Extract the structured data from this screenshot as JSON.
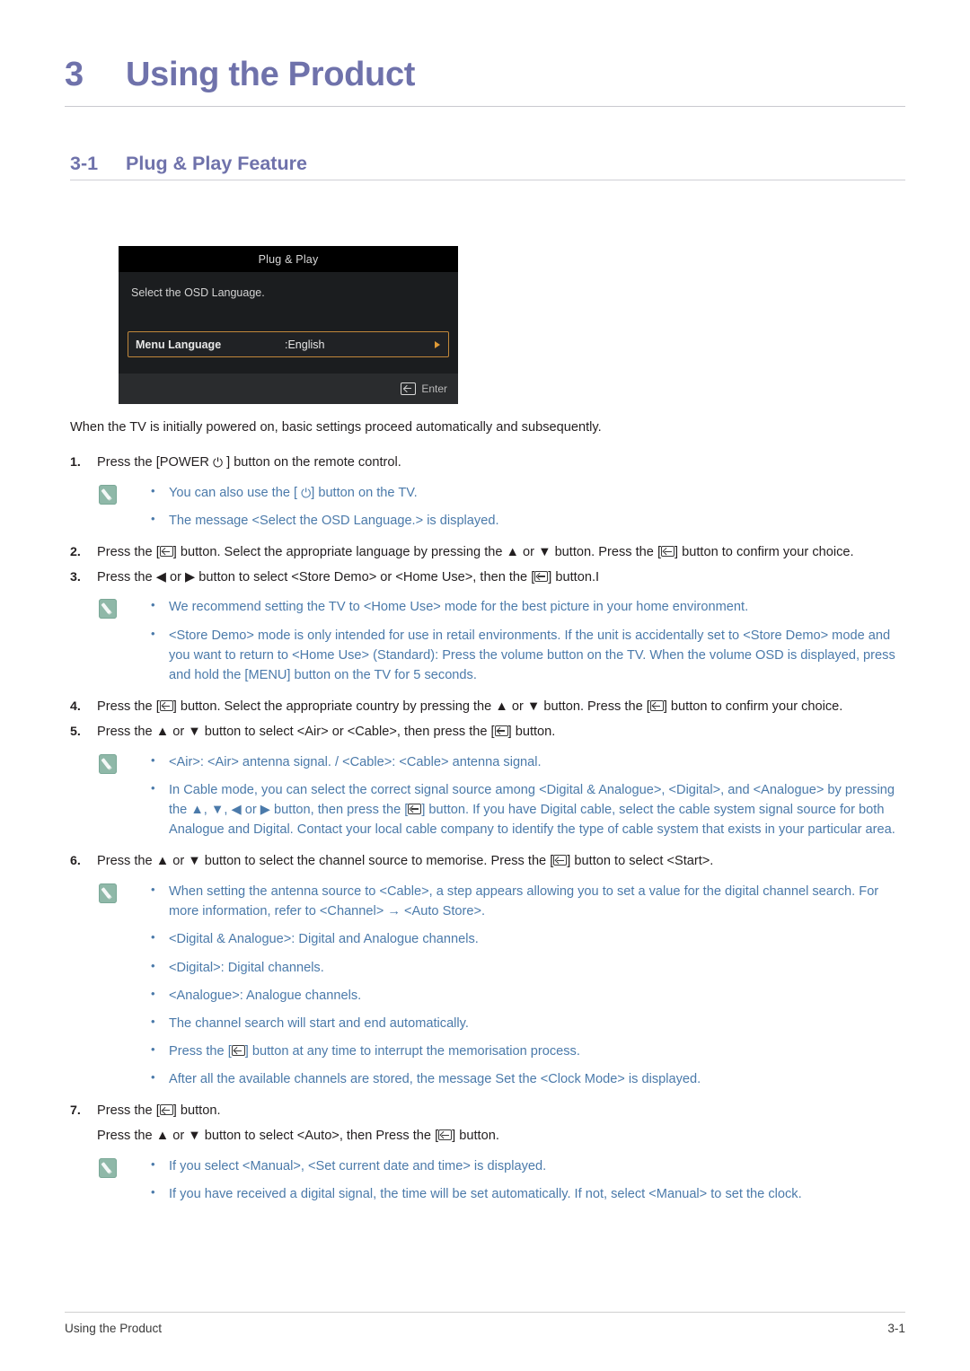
{
  "chapter": {
    "number": "3",
    "title": "Using the Product"
  },
  "section": {
    "number": "3-1",
    "title": "Plug & Play Feature"
  },
  "figure": {
    "name": "plug-and-play-osd",
    "title": "Plug & Play",
    "prompt": "Select the OSD Language.",
    "row_label": "Menu Language",
    "row_value": ":English",
    "footer_action": "Enter",
    "colors": {
      "titlebar_bg": "#000000",
      "body_bg": "#1b1d1f",
      "footer_bg": "#2a2c2e",
      "highlight_border": "#c0873a",
      "arrow": "#e09a36"
    }
  },
  "intro": "When the TV is initially powered on, basic settings proceed automatically and subsequently.",
  "steps": [
    {
      "number": "1.",
      "text_before": "Press the [POWER ",
      "icon": "power-icon",
      "text_after": " ] button on the remote control."
    },
    {
      "number": "2.",
      "parts": [
        "Press the [",
        "] button. Select the appropriate language by pressing the ▲ or ▼ button. Press the [",
        "] button to confirm your choice."
      ]
    },
    {
      "number": "3.",
      "parts": [
        "Press the ◀ or ▶ button to select <Store Demo> or <Home Use>, then the [",
        "] button.I"
      ]
    },
    {
      "number": "4.",
      "parts": [
        "Press the [",
        "] button. Select the appropriate country by pressing the ▲ or ▼ button. Press the [",
        "] button to confirm your choice."
      ]
    },
    {
      "number": "5.",
      "parts": [
        "Press the ▲ or ▼ button to select <Air> or <Cable>, then press the [",
        "] button."
      ]
    },
    {
      "number": "6.",
      "parts": [
        "Press the ▲ or ▼ button to select the channel source to memorise. Press the [",
        "] button to select <Start>."
      ]
    },
    {
      "number": "7.",
      "parts": [
        "Press the [",
        "] button."
      ],
      "substep_parts": [
        "Press the ▲ or ▼ button to select <Auto>, then Press the [",
        "] button."
      ]
    }
  ],
  "notes": [
    {
      "id": "note-after-step-1",
      "items": [
        {
          "parts": [
            "You can also use the [ ",
            "] button on the TV."
          ],
          "inline_icon": "power-icon"
        },
        {
          "text": "The message <Select the OSD Language.> is displayed."
        }
      ]
    },
    {
      "id": "note-after-step-3",
      "items": [
        {
          "text": "We recommend setting the TV to <Home Use> mode for the best picture in your home environment."
        },
        {
          "text": "<Store Demo> mode is only intended for use in retail environments. If the unit is accidentally set to <Store Demo> mode and you want to return to <Home Use> (Standard): Press the volume button on the TV. When the volume OSD is displayed, press and hold the [MENU] button on the TV for 5 seconds."
        }
      ]
    },
    {
      "id": "note-after-step-5",
      "items": [
        {
          "text": "<Air>: <Air> antenna signal. / <Cable>: <Cable> antenna signal."
        },
        {
          "parts": [
            "In Cable mode, you can select the correct signal source among <Digital & Analogue>, <Digital>, and <Analogue> by pressing the ▲, ▼, ◀ or ▶ button, then press the [",
            "] button. If you have Digital cable, select the cable system signal source for both Analogue and Digital. Contact your local cable company to identify the type of cable system that exists in your particular area."
          ],
          "inline_icon": "enter-key-icon"
        }
      ]
    },
    {
      "id": "note-after-step-6",
      "items": [
        {
          "text": "When setting the antenna source to <Cable>, a step appears allowing you to set a value for the digital channel search. For more information, refer to <Channel> → <Auto Store>."
        },
        {
          "text": "<Digital & Analogue>: Digital and Analogue channels."
        },
        {
          "text": "<Digital>: Digital channels."
        },
        {
          "text": "<Analogue>: Analogue channels."
        },
        {
          "text": "The channel search will start and end automatically."
        },
        {
          "parts": [
            "Press the [",
            "] button at any time to interrupt the memorisation process."
          ],
          "inline_icon": "enter-key-icon"
        },
        {
          "text": "After all the available channels are stored, the message Set the <Clock Mode> is displayed."
        }
      ]
    },
    {
      "id": "note-after-step-7",
      "items": [
        {
          "text": "If you select <Manual>, <Set current date and time> is displayed."
        },
        {
          "text": "If you have received a digital signal, the time will be set automatically. If not, select <Manual> to set the clock."
        }
      ]
    }
  ],
  "footer": {
    "left": "Using the Product",
    "right": "3-1"
  },
  "colors": {
    "heading": "#6f72ab",
    "note_text": "#4b7aaa",
    "body_text": "#231f20",
    "note_icon_bg": "#8fb8a8"
  }
}
